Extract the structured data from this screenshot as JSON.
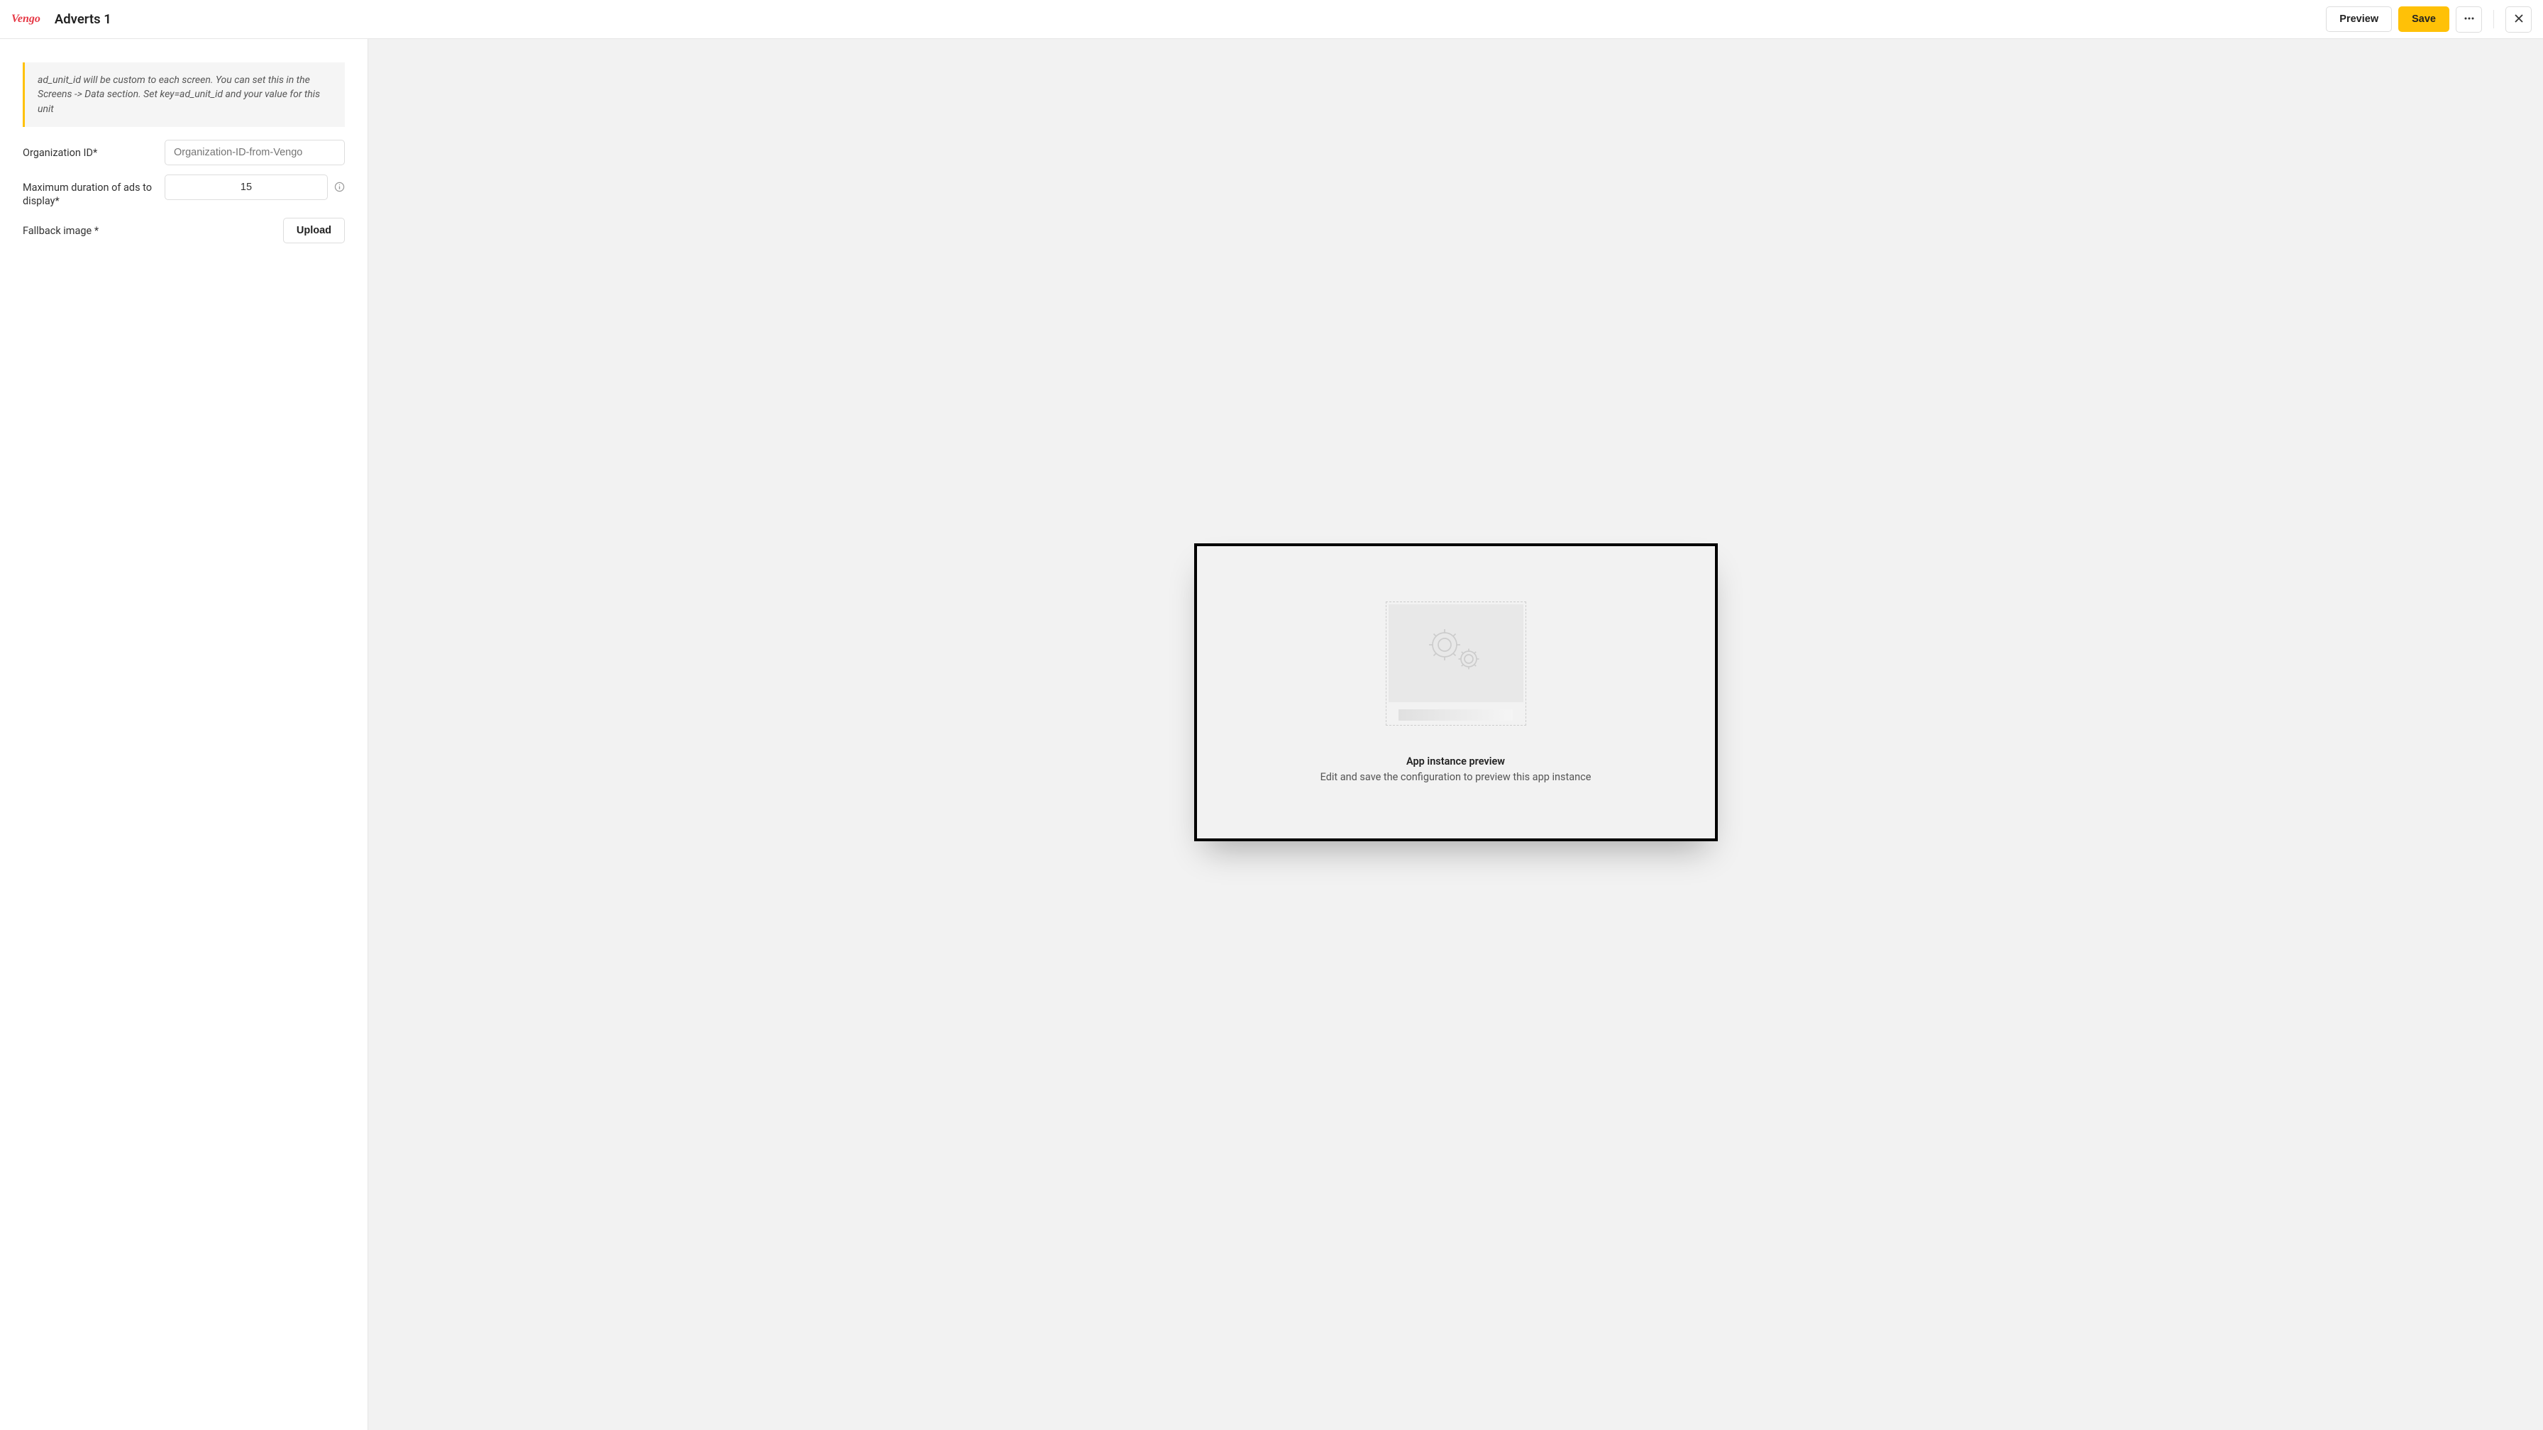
{
  "header": {
    "logo": "Vengo",
    "title": "Adverts 1",
    "preview_label": "Preview",
    "save_label": "Save"
  },
  "form": {
    "info_text": "ad_unit_id will be custom to each screen. You can set this in the Screens -> Data section. Set key=ad_unit_id and your value for this unit",
    "org_id_label": "Organization ID*",
    "org_id_placeholder": "Organization-ID-from-Vengo",
    "duration_label": "Maximum duration of ads to display*",
    "duration_value": "15",
    "fallback_label": "Fallback image *",
    "upload_label": "Upload"
  },
  "preview": {
    "title": "App instance preview",
    "subtitle": "Edit and save the configuration to preview this app instance"
  }
}
